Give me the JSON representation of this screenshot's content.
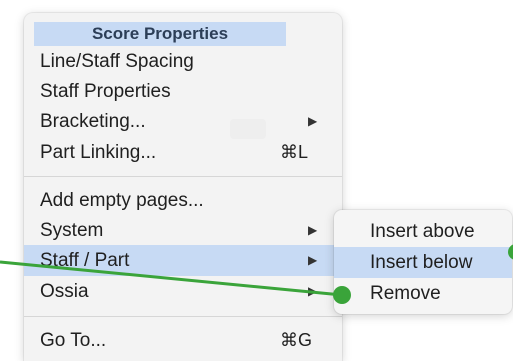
{
  "menu": {
    "header": "Score Properties",
    "items": [
      {
        "label": "Line/Staff Spacing"
      },
      {
        "label": "Staff Properties"
      },
      {
        "label": "Bracketing...",
        "arrow": "▶"
      },
      {
        "label": "Part Linking...",
        "shortcut": "⌘L"
      },
      {
        "label": "Add empty pages..."
      },
      {
        "label": "System",
        "arrow": "▶"
      },
      {
        "label": "Staff / Part",
        "arrow": "▶"
      },
      {
        "label": "Ossia",
        "arrow": "▶"
      },
      {
        "label": "Go To...",
        "shortcut": "⌘G"
      }
    ]
  },
  "submenu": {
    "items": [
      {
        "label": "Insert above"
      },
      {
        "label": "Insert below"
      },
      {
        "label": "Remove"
      }
    ]
  },
  "colors": {
    "highlight": "#c7daf4",
    "annotation_green": "#3aa43a"
  }
}
